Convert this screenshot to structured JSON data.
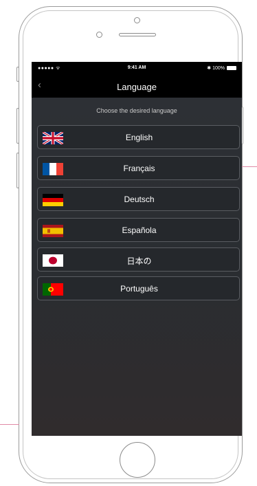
{
  "status_bar": {
    "carrier": "●●●●● ᯤ",
    "time": "9:41 AM",
    "battery": "✱ 100%"
  },
  "nav": {
    "back_icon": "‹",
    "title": "Language"
  },
  "instruction": "Choose the desired language",
  "languages": [
    {
      "label": "English",
      "flag": "uk-flag-icon"
    },
    {
      "label": "Français",
      "flag": "france-flag-icon"
    },
    {
      "label": "Deutsch",
      "flag": "germany-flag-icon"
    },
    {
      "label": "Española",
      "flag": "spain-flag-icon"
    },
    {
      "label": "日本の",
      "flag": "japan-flag-icon"
    },
    {
      "label": "Português",
      "flag": "portugal-flag-icon"
    }
  ],
  "colors": {
    "header_background": "#000000",
    "screen_background": "#2e3136",
    "row_border": "#5a5d62",
    "annotation_line": "#e08aa6"
  }
}
